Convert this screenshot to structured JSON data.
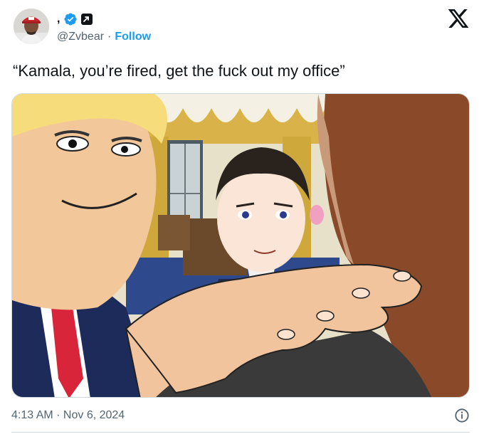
{
  "author": {
    "display_name": ",",
    "handle": "@Zvbear",
    "separator": "·",
    "follow_label": "Follow",
    "verified_color": "#1d9bf0"
  },
  "icons": {
    "avatar": "avatar-photo",
    "verified": "verified-badge-icon",
    "affiliate": "affiliate-badge-icon",
    "platform": "x-logo-icon",
    "info": "info-icon"
  },
  "tweet": {
    "text": "“Kamala, you’re fired, get the fuck out my office”"
  },
  "media": {
    "kind": "cartoon-illustration"
  },
  "footer": {
    "timestamp": "4:13 AM · Nov 6, 2024"
  },
  "colors": {
    "text_primary": "#0f1419",
    "text_secondary": "#536471",
    "accent": "#1d9bf0",
    "border": "#cfd9de"
  }
}
